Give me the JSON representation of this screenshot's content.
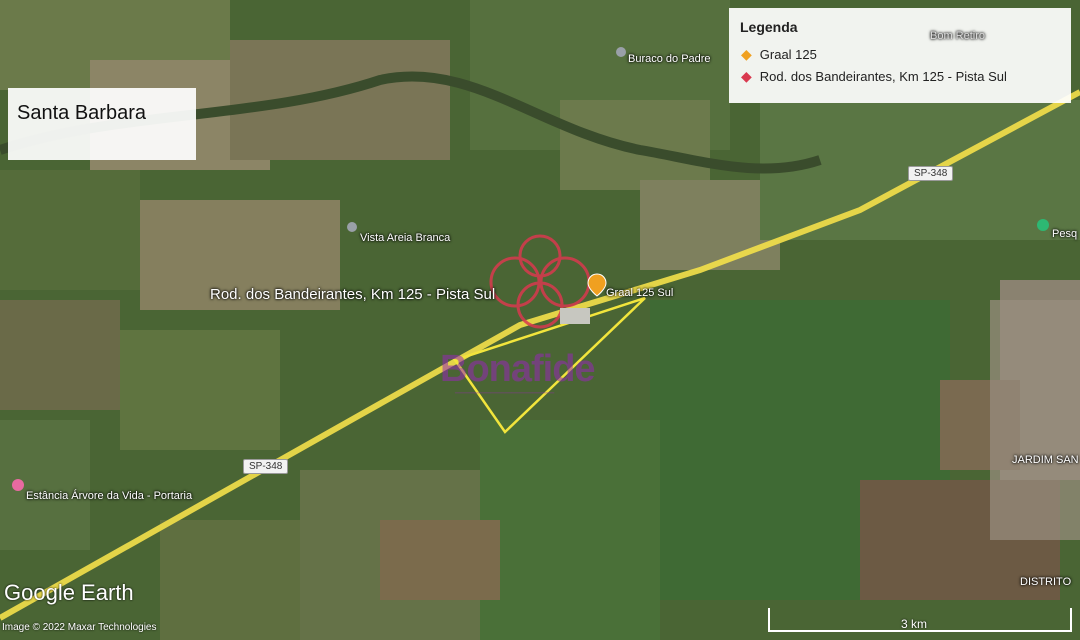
{
  "map": {
    "title": "Santa Barbara",
    "legend": {
      "title": "Legenda",
      "items": [
        {
          "label": "Graal 125",
          "icon": "orange-pin-icon",
          "color": "#f0a020"
        },
        {
          "label": "Rod. dos Bandeirantes, Km 125 - Pista Sul",
          "icon": "red-pin-icon",
          "color": "#d9394f"
        }
      ]
    },
    "places": {
      "buraco": "Buraco do Padre",
      "areia": "Vista Areia Branca",
      "rod": "Rod. dos Bandeirantes, Km 125 - Pista Sul",
      "graal": "Graal 125 Sul",
      "estancia": "Estância Árvore da Vida - Portaria",
      "bom_retiro": "Bom Retiro",
      "jardim": "JARDIM SAN",
      "distrito": "DISTRITO",
      "pesq": "Pesq"
    },
    "roads": {
      "sp348_a": "SP-348",
      "sp348_b": "SP-348"
    },
    "watermark": "Bonafide",
    "branding": "Google Earth",
    "copyright": "Image © 2022 Maxar Technologies",
    "scale_label": "3 km",
    "colors": {
      "highway": "#f4e04a",
      "boundary": "#f2e53c",
      "marker": "#d9394f",
      "graal_pin": "#f0a020"
    }
  }
}
